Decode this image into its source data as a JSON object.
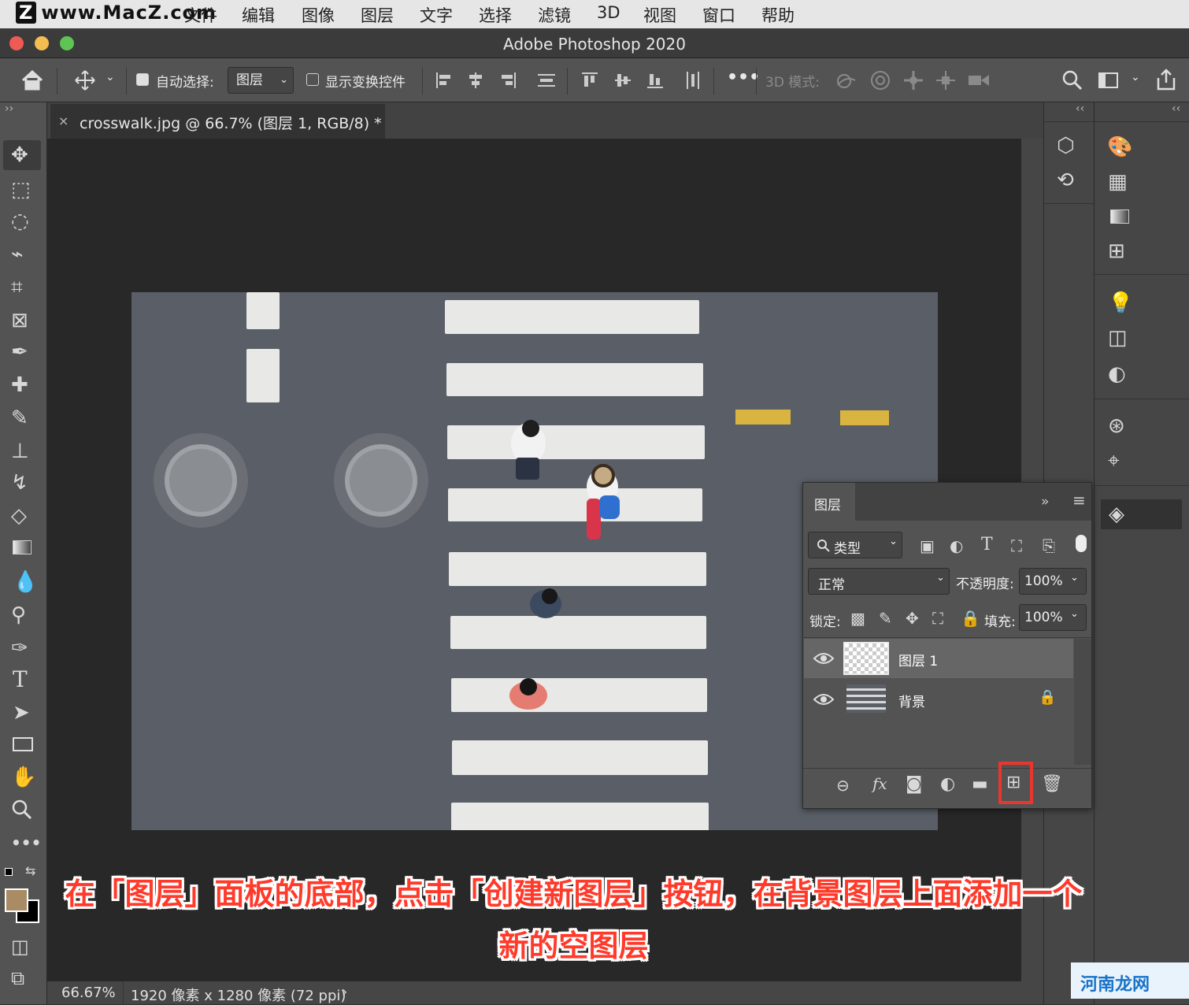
{
  "menubar": {
    "watermark": "www.MacZ.com",
    "watermark_logo": "Z",
    "items": [
      "文件",
      "编辑",
      "图像",
      "图层",
      "文字",
      "选择",
      "滤镜",
      "3D",
      "视图",
      "窗口",
      "帮助"
    ]
  },
  "window": {
    "title": "Adobe Photoshop 2020"
  },
  "options_bar": {
    "auto_select_label": "自动选择:",
    "auto_select_value": "图层",
    "show_transform_label": "显示变换控件",
    "mode_3d_label": "3D 模式:"
  },
  "document": {
    "tab_label": "crosswalk.jpg @ 66.7% (图层 1, RGB/8) *",
    "zoom": "66.67%",
    "info": "1920 像素 x 1280 像素 (72 ppi)"
  },
  "layers_panel": {
    "title": "图层",
    "filter_label": "类型",
    "blend_mode": "正常",
    "opacity_label": "不透明度:",
    "opacity_value": "100%",
    "lock_label": "锁定:",
    "fill_label": "填充:",
    "fill_value": "100%",
    "layers": [
      {
        "name": "图层 1",
        "selected": true
      },
      {
        "name": "背景",
        "locked": true
      }
    ]
  },
  "caption": {
    "line1": "在「图层」面板的底部，点击「创建新图层」按钮，在背景图层上面添加一个",
    "line2": "新的空图层"
  },
  "brand": {
    "text": "河南龙网"
  },
  "colors": {
    "highlight_box": "#e8372e",
    "caption_text": "#ff3a2a",
    "foreground_swatch": "#a98c63"
  }
}
